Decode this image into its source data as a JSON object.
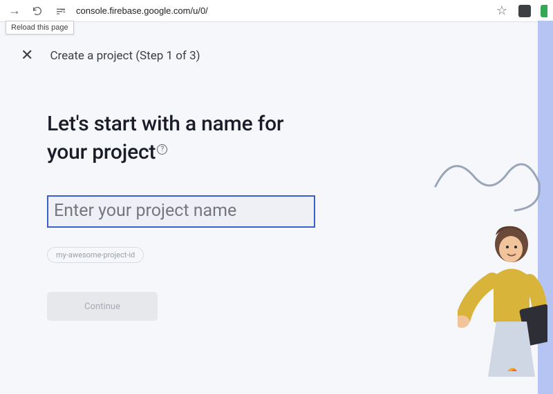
{
  "browser": {
    "url": "console.firebase.google.com/u/0/",
    "tooltip": "Reload this page"
  },
  "header": {
    "step_title": "Create a project (Step 1 of 3)"
  },
  "main": {
    "heading_line1": "Let's start with a name for",
    "heading_line2": "your project",
    "help_symbol": "?",
    "input_placeholder": "Enter your project name",
    "input_value": "",
    "project_id_chip": "my-awesome-project-id",
    "continue_label": "Continue"
  }
}
